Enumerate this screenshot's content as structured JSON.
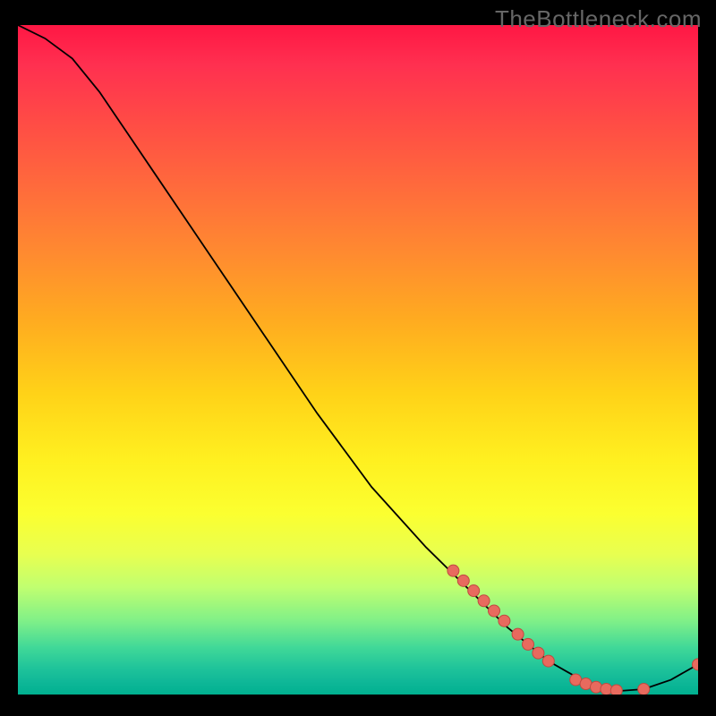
{
  "watermark": "TheBottleneck.com",
  "chart_data": {
    "type": "line",
    "title": "",
    "xlabel": "",
    "ylabel": "",
    "xlim": [
      0,
      100
    ],
    "ylim": [
      0,
      100
    ],
    "curve": [
      {
        "x": 0,
        "y": 100
      },
      {
        "x": 4,
        "y": 98
      },
      {
        "x": 8,
        "y": 95
      },
      {
        "x": 12,
        "y": 90
      },
      {
        "x": 16,
        "y": 84
      },
      {
        "x": 20,
        "y": 78
      },
      {
        "x": 28,
        "y": 66
      },
      {
        "x": 36,
        "y": 54
      },
      {
        "x": 44,
        "y": 42
      },
      {
        "x": 52,
        "y": 31
      },
      {
        "x": 60,
        "y": 22
      },
      {
        "x": 66,
        "y": 16
      },
      {
        "x": 72,
        "y": 10
      },
      {
        "x": 78,
        "y": 5
      },
      {
        "x": 84,
        "y": 1.5
      },
      {
        "x": 88,
        "y": 0.5
      },
      {
        "x": 92,
        "y": 0.8
      },
      {
        "x": 96,
        "y": 2.2
      },
      {
        "x": 100,
        "y": 4.5
      }
    ],
    "dots": [
      {
        "x": 64,
        "y": 18.5
      },
      {
        "x": 65.5,
        "y": 17
      },
      {
        "x": 67,
        "y": 15.5
      },
      {
        "x": 68.5,
        "y": 14
      },
      {
        "x": 70,
        "y": 12.5
      },
      {
        "x": 71.5,
        "y": 11
      },
      {
        "x": 73.5,
        "y": 9
      },
      {
        "x": 75,
        "y": 7.5
      },
      {
        "x": 76.5,
        "y": 6.2
      },
      {
        "x": 78,
        "y": 5
      },
      {
        "x": 82,
        "y": 2.2
      },
      {
        "x": 83.5,
        "y": 1.6
      },
      {
        "x": 85,
        "y": 1.1
      },
      {
        "x": 86.5,
        "y": 0.8
      },
      {
        "x": 88,
        "y": 0.6
      },
      {
        "x": 92,
        "y": 0.8
      },
      {
        "x": 100,
        "y": 4.5
      }
    ],
    "gradient_colors": {
      "top": "#ff1744",
      "mid": "#ffd218",
      "bottom": "#00b090"
    }
  }
}
